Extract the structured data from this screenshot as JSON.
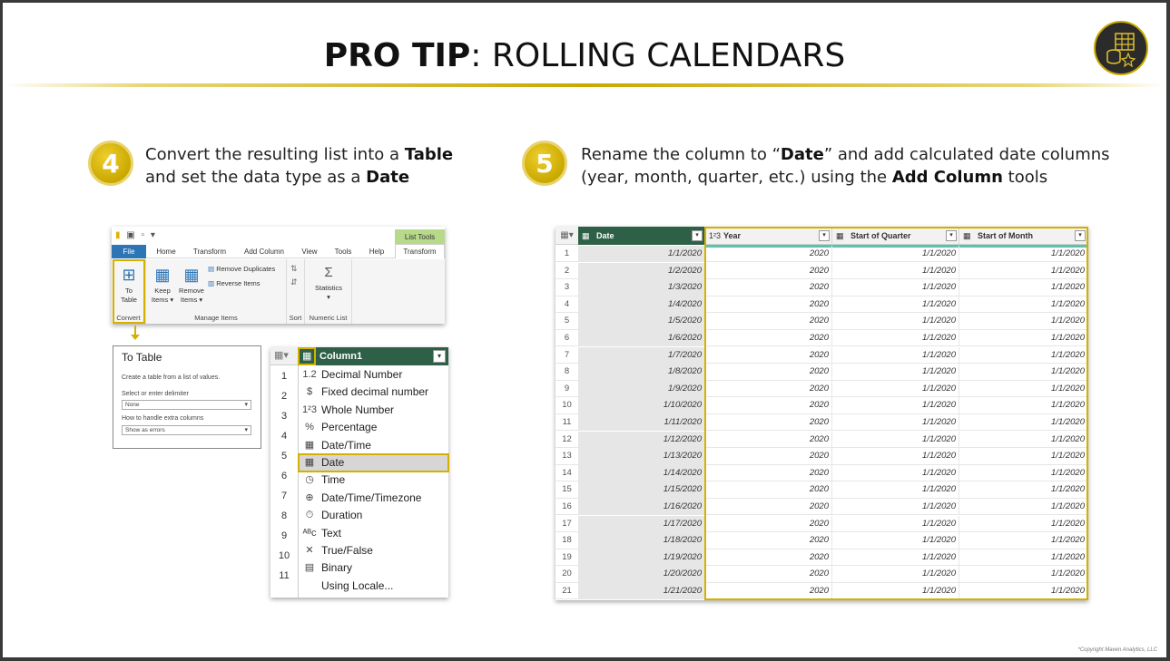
{
  "slide": {
    "title_bold": "PRO TIP",
    "title_rest": ": ROLLING CALENDARS",
    "copyright": "*Copyright Maven Analytics, LLC"
  },
  "colors": {
    "accent": "#c9a800",
    "highlight": "#d4b000",
    "header_green": "#2d6046"
  },
  "step4": {
    "number": "4",
    "line1_pre": "Convert the resulting list into a ",
    "line1_bold": "Table",
    "line2_pre": "and set the data type as a ",
    "line2_bold": "Date"
  },
  "step5": {
    "number": "5",
    "line1_pre": "Rename the column to “",
    "line1_bold": "Date",
    "line1_post": "” and add calculated date columns",
    "line2_pre": "(year, month, quarter, etc.) using the ",
    "line2_bold": "Add Column",
    "line2_post": " tools"
  },
  "ribbon": {
    "context_tab": "List Tools",
    "tabs": [
      "File",
      "Home",
      "Transform",
      "Add Column",
      "View",
      "Tools",
      "Help",
      "Transform"
    ],
    "to_table_l1": "To",
    "to_table_l2": "Table",
    "keep_l1": "Keep",
    "keep_l2": "Items ▾",
    "remove_l1": "Remove",
    "remove_l2": "Items ▾",
    "remove_duplicates": "Remove Duplicates",
    "reverse_items": "Reverse Items",
    "statistics": "Statistics",
    "statistics_arrow": "▾",
    "groups": {
      "convert": "Convert",
      "manage": "Manage Items",
      "sort": "Sort",
      "numeric": "Numeric List"
    }
  },
  "dialog": {
    "title": "To Table",
    "description": "Create a table from a list of values.",
    "delimiter_label": "Select or enter delimiter",
    "delimiter_value": "None",
    "extra_label": "How to handle extra columns",
    "extra_value": "Show as errors"
  },
  "type_menu": {
    "column_header": "Column1",
    "row_numbers": [
      "1",
      "2",
      "3",
      "4",
      "5",
      "6",
      "7",
      "8",
      "9",
      "10",
      "11"
    ],
    "items": [
      {
        "icon": "1.2",
        "label": "Decimal Number"
      },
      {
        "icon": "$",
        "label": "Fixed decimal number"
      },
      {
        "icon": "1²3",
        "label": "Whole Number"
      },
      {
        "icon": "%",
        "label": "Percentage"
      },
      {
        "icon": "▦",
        "label": "Date/Time"
      },
      {
        "icon": "▦",
        "label": "Date",
        "selected": true
      },
      {
        "icon": "◷",
        "label": "Time"
      },
      {
        "icon": "⊕",
        "label": "Date/Time/Timezone"
      },
      {
        "icon": "⏱",
        "label": "Duration"
      },
      {
        "icon": "ᴬᴮc",
        "label": "Text"
      },
      {
        "icon": "✕",
        "label": "True/False"
      },
      {
        "icon": "▤",
        "label": "Binary"
      },
      {
        "icon": "",
        "label": "Using Locale..."
      }
    ]
  },
  "grid": {
    "headers": [
      {
        "icon": "▦",
        "label": "Date"
      },
      {
        "icon": "1²3",
        "label": "Year"
      },
      {
        "icon": "▦",
        "label": "Start of Quarter"
      },
      {
        "icon": "▦",
        "label": "Start of Month"
      }
    ],
    "rows": [
      [
        "1",
        "1/1/2020",
        "2020",
        "1/1/2020",
        "1/1/2020"
      ],
      [
        "2",
        "1/2/2020",
        "2020",
        "1/1/2020",
        "1/1/2020"
      ],
      [
        "3",
        "1/3/2020",
        "2020",
        "1/1/2020",
        "1/1/2020"
      ],
      [
        "4",
        "1/4/2020",
        "2020",
        "1/1/2020",
        "1/1/2020"
      ],
      [
        "5",
        "1/5/2020",
        "2020",
        "1/1/2020",
        "1/1/2020"
      ],
      [
        "6",
        "1/6/2020",
        "2020",
        "1/1/2020",
        "1/1/2020"
      ],
      [
        "7",
        "1/7/2020",
        "2020",
        "1/1/2020",
        "1/1/2020"
      ],
      [
        "8",
        "1/8/2020",
        "2020",
        "1/1/2020",
        "1/1/2020"
      ],
      [
        "9",
        "1/9/2020",
        "2020",
        "1/1/2020",
        "1/1/2020"
      ],
      [
        "10",
        "1/10/2020",
        "2020",
        "1/1/2020",
        "1/1/2020"
      ],
      [
        "11",
        "1/11/2020",
        "2020",
        "1/1/2020",
        "1/1/2020"
      ],
      [
        "12",
        "1/12/2020",
        "2020",
        "1/1/2020",
        "1/1/2020"
      ],
      [
        "13",
        "1/13/2020",
        "2020",
        "1/1/2020",
        "1/1/2020"
      ],
      [
        "14",
        "1/14/2020",
        "2020",
        "1/1/2020",
        "1/1/2020"
      ],
      [
        "15",
        "1/15/2020",
        "2020",
        "1/1/2020",
        "1/1/2020"
      ],
      [
        "16",
        "1/16/2020",
        "2020",
        "1/1/2020",
        "1/1/2020"
      ],
      [
        "17",
        "1/17/2020",
        "2020",
        "1/1/2020",
        "1/1/2020"
      ],
      [
        "18",
        "1/18/2020",
        "2020",
        "1/1/2020",
        "1/1/2020"
      ],
      [
        "19",
        "1/19/2020",
        "2020",
        "1/1/2020",
        "1/1/2020"
      ],
      [
        "20",
        "1/20/2020",
        "2020",
        "1/1/2020",
        "1/1/2020"
      ],
      [
        "21",
        "1/21/2020",
        "2020",
        "1/1/2020",
        "1/1/2020"
      ]
    ]
  }
}
